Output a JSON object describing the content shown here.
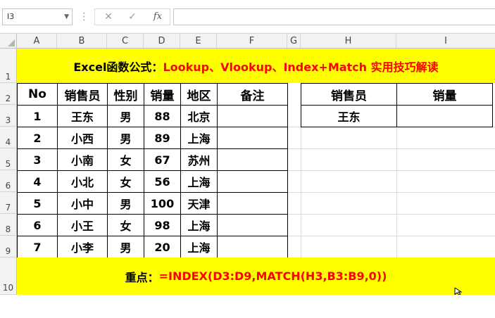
{
  "namebox": {
    "value": "I3",
    "chevron": "chevron-down-icon"
  },
  "formula_bar": {
    "dots": "⋮",
    "cancel_icon": "✕",
    "enter_icon": "✓",
    "fx_label": "fx",
    "formula": ""
  },
  "columns": [
    "A",
    "B",
    "C",
    "D",
    "E",
    "F",
    "G",
    "H",
    "I"
  ],
  "rows": [
    "1",
    "2",
    "3",
    "4",
    "5",
    "6",
    "7",
    "8",
    "9",
    "10"
  ],
  "title": {
    "prefix": "Excel函数公式：",
    "rest": "Lookup、Vlookup、Index+Match 实用技巧解读"
  },
  "table": {
    "headers": [
      "No",
      "销售员",
      "性别",
      "销量",
      "地区",
      "备注"
    ],
    "rows": [
      [
        "1",
        "王东",
        "男",
        "88",
        "北京",
        ""
      ],
      [
        "2",
        "小西",
        "男",
        "89",
        "上海",
        ""
      ],
      [
        "3",
        "小南",
        "女",
        "67",
        "苏州",
        ""
      ],
      [
        "4",
        "小北",
        "女",
        "56",
        "上海",
        ""
      ],
      [
        "5",
        "小中",
        "男",
        "100",
        "天津",
        ""
      ],
      [
        "6",
        "小王",
        "女",
        "98",
        "上海",
        ""
      ],
      [
        "7",
        "小李",
        "男",
        "20",
        "上海",
        ""
      ]
    ]
  },
  "lookup": {
    "headers": [
      "销售员",
      "销量"
    ],
    "row": [
      "王东",
      ""
    ]
  },
  "footer": {
    "label": "重点：",
    "formula": "=INDEX(D3:D9,MATCH(H3,B3:B9,0))"
  },
  "colors": {
    "band": "#ffff00",
    "accent_red": "#ff0000",
    "header_gray": "#f2f2f2"
  }
}
